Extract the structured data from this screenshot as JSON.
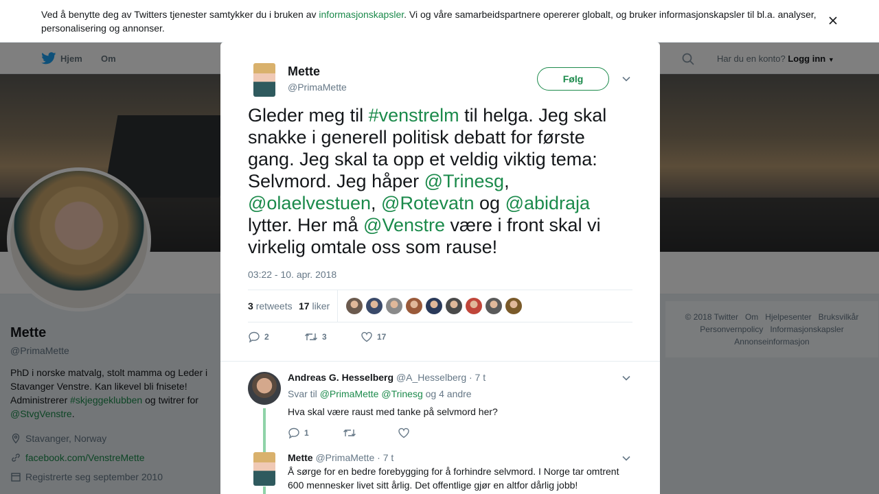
{
  "cookie": {
    "text_before": "Ved å benytte deg av Twitters tjenester samtykker du i bruken av ",
    "link": "informasjonskapsler",
    "text_after": ". Vi og våre samarbeidspartnere opererer globalt, og bruker informasjonskapsler til bl.a. analyser, personalisering og annonser."
  },
  "nav": {
    "home": "Hjem",
    "about": "Om",
    "have_account": "Har du en konto?",
    "login": "Logg inn"
  },
  "profile": {
    "name": "Mette",
    "handle": "@PrimaMette",
    "bio_1": "PhD i norske matvalg, stolt mamma og Leder i Stavanger Venstre. Kan likevel bli fnisete! Administrerer ",
    "bio_hashtag": "#skjeggeklubben",
    "bio_2": " og twitrer for ",
    "bio_mention": "@StvgVenstre",
    "bio_3": ".",
    "location": "Stavanger, Norway",
    "website": "facebook.com/VenstreMette",
    "joined": "Registrerte seg september 2010"
  },
  "footer": {
    "items": [
      "© 2018 Twitter",
      "Om",
      "Hjelpesenter",
      "Bruksvilkår",
      "Personvernpolicy",
      "Informasjonskapsler",
      "Annonseinformasjon"
    ]
  },
  "tweet": {
    "author_name": "Mette",
    "author_handle": "@PrimaMette",
    "follow_label": "Følg",
    "segments": [
      {
        "t": "Gleder meg til ",
        "link": false
      },
      {
        "t": "#venstrelm",
        "link": true
      },
      {
        "t": " til helga. Jeg skal snakke i generell politisk debatt for første gang. Jeg skal ta opp et veldig viktig tema: Selvmord. Jeg håper ",
        "link": false
      },
      {
        "t": "@Trinesg",
        "link": true
      },
      {
        "t": ", ",
        "link": false
      },
      {
        "t": "@olaelvestuen",
        "link": true
      },
      {
        "t": ", ",
        "link": false
      },
      {
        "t": "@Rotevatn",
        "link": true
      },
      {
        "t": " og ",
        "link": false
      },
      {
        "t": "@abidraja",
        "link": true
      },
      {
        "t": " lytter. Her må ",
        "link": false
      },
      {
        "t": "@Venstre",
        "link": true
      },
      {
        "t": " være i front skal vi virkelig omtale oss som rause!",
        "link": false
      }
    ],
    "time": "03:22 - 10. apr. 2018",
    "retweets_count": "3",
    "retweets_label": "retweets",
    "likes_count": "17",
    "likes_label": "liker",
    "liker_colors": [
      "#6b5a4e",
      "#3a4a6a",
      "#8a8a8a",
      "#9a5a3a",
      "#2a3a5a",
      "#4a4a4a",
      "#c0463a",
      "#5a5a5a",
      "#7a5a2a"
    ],
    "reply_count": "2",
    "retweet_count": "3",
    "like_count": "17"
  },
  "replies": [
    {
      "name": "Andreas G. Hesselberg",
      "handle": "@A_Hesselberg",
      "time": "· 7 t",
      "to_label": "Svar til ",
      "to_mentions": "@PrimaMette @Trinesg",
      "to_rest": " og 4 andre",
      "text": "Hva skal være raust med tanke på selvmord her?",
      "reply_count": "1"
    },
    {
      "name": "Mette",
      "handle": "@PrimaMette",
      "time": "· 7 t",
      "text": "Å sørge for en bedre forebygging for å forhindre selvmord. I Norge tar omtrent 600 mennesker livet sitt årlig. Det offentlige gjør en altfor dårlig jobb!"
    }
  ],
  "colors": {
    "accent": "#1b8a4b",
    "thread": "#8fd3a8",
    "muted": "#657786"
  }
}
